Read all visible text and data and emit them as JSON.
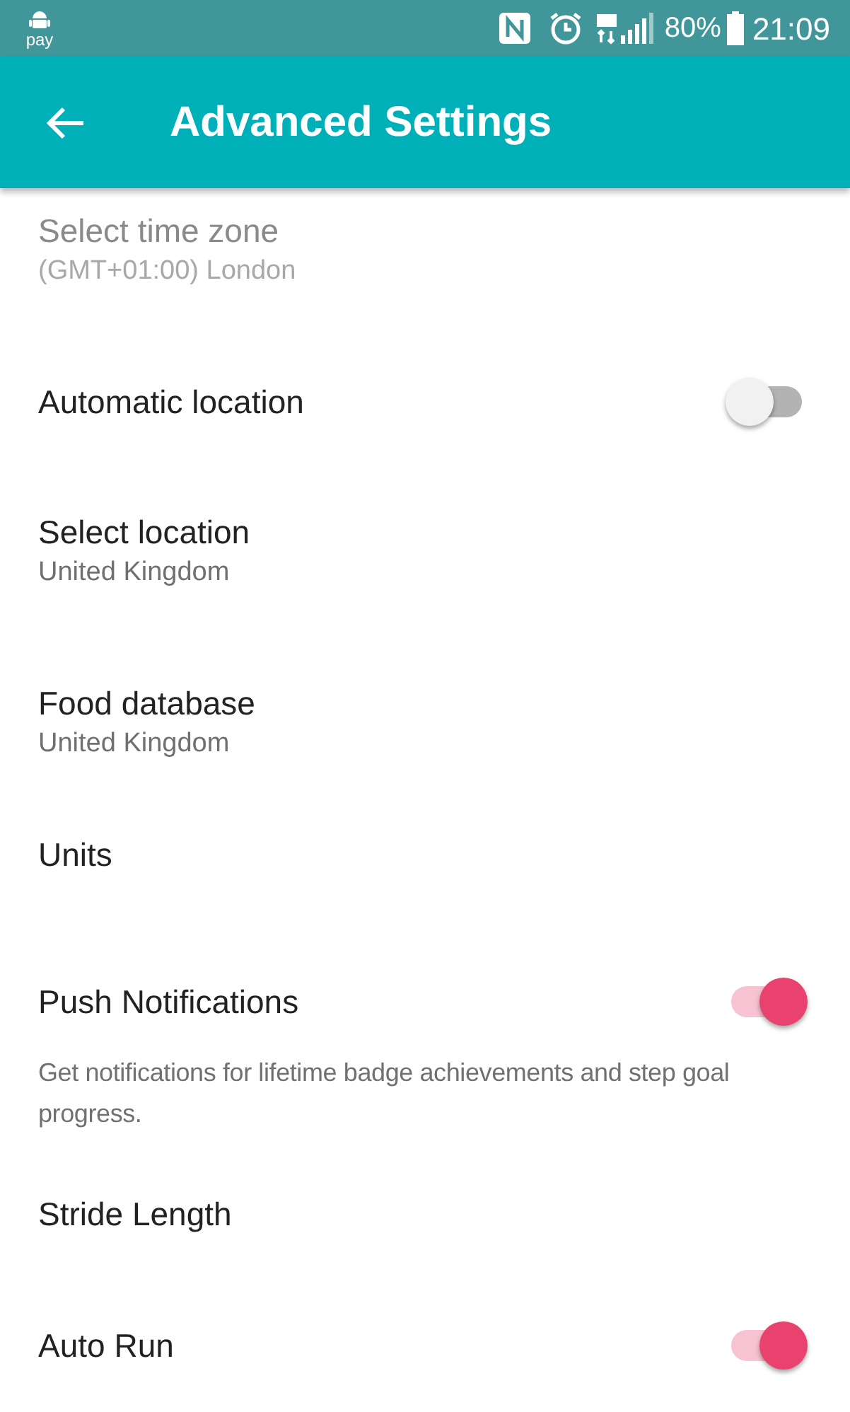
{
  "status_bar": {
    "left_label": "pay",
    "battery": "80%",
    "time": "21:09"
  },
  "app_bar": {
    "title": "Advanced Settings"
  },
  "settings": [
    {
      "kind": "detail",
      "title": "Select time zone",
      "subtitle": "(GMT+01:00) London",
      "disabled": true
    },
    {
      "kind": "switch",
      "title": "Automatic location",
      "on": false
    },
    {
      "kind": "detail",
      "title": "Select location",
      "subtitle": "United Kingdom",
      "disabled": false
    },
    {
      "kind": "detail",
      "title": "Food database",
      "subtitle": "United Kingdom",
      "disabled": false
    },
    {
      "kind": "plain",
      "title": "Units"
    },
    {
      "kind": "switch",
      "title": "Push Notifications",
      "on": true,
      "description": "Get notifications for lifetime badge achievements and step goal progress."
    },
    {
      "kind": "plain",
      "title": "Stride Length"
    },
    {
      "kind": "switch",
      "title": "Auto Run",
      "on": true
    }
  ]
}
